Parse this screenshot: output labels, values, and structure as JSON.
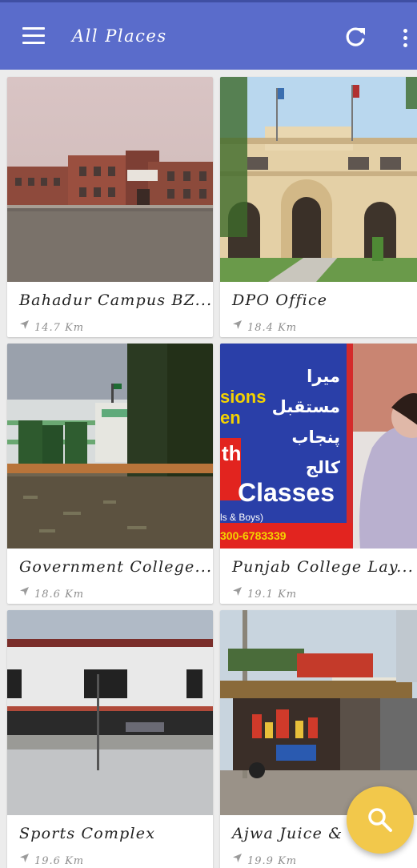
{
  "app_bar": {
    "title": "All Places",
    "menu_icon": "hamburger-menu-icon",
    "refresh_icon": "refresh-icon",
    "more_icon": "more-vertical-icon",
    "color": "#5a6ccb"
  },
  "places": [
    {
      "name": "Bahadur Campus BZ...",
      "distance": "14.7 Km",
      "photo": "campus-building-photo"
    },
    {
      "name": "DPO Office",
      "distance": "18.4 Km",
      "photo": "dpo-office-photo"
    },
    {
      "name": "Government College...",
      "distance": "18.6 Km",
      "photo": "college-courtyard-photo"
    },
    {
      "name": "Punjab College Lay...",
      "distance": "19.1 Km",
      "photo": "college-banner-photo"
    },
    {
      "name": "Sports Complex",
      "distance": "19.6 Km",
      "photo": "sports-complex-photo"
    },
    {
      "name": "Ajwa Juice &",
      "distance": "19.9 Km",
      "photo": "juice-shop-photo"
    }
  ],
  "banner": {
    "urdu_line_1": "میرا مستقبل",
    "urdu_line_2": "پنجاب کالج",
    "fragment_1": "sions",
    "fragment_2": "en",
    "fragment_3": "th",
    "classes_text": "Classes",
    "boys_text": "ls & Boys)",
    "phone": "300-6783339"
  },
  "fab": {
    "icon": "search-icon",
    "color": "#f2c84b"
  }
}
